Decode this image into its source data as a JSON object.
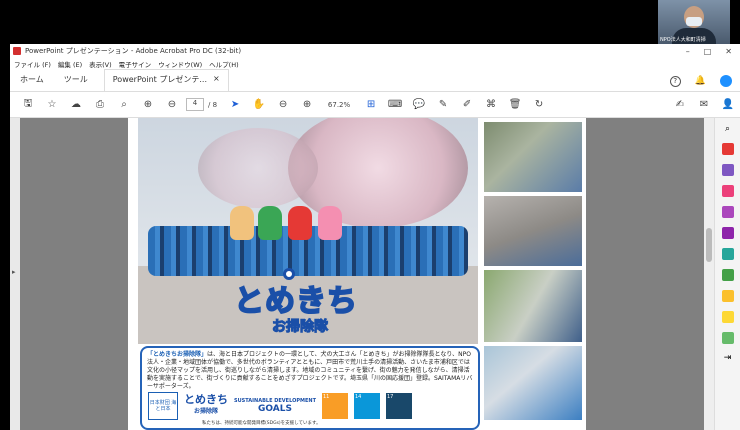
{
  "camera": {
    "name": "NPO法人大和町清掃"
  },
  "window": {
    "title": "PowerPoint プレゼンテーション - Adobe Acrobat Pro DC (32-bit)"
  },
  "menu": [
    "ファイル (F)",
    "編集 (E)",
    "表示(V)",
    "電子サイン",
    "ウィンドウ(W)",
    "ヘルプ(H)"
  ],
  "tabs": {
    "home": "ホーム",
    "tools": "ツール",
    "doc": "PowerPoint プレゼンテ...",
    "close": "×"
  },
  "toolbar": {
    "page": "4",
    "page_count": "/ 8",
    "zoom": "67.2%"
  },
  "page": {
    "logo_main": "とめきち",
    "logo_sub": "お掃除隊",
    "info_highlight": "「とめきちお掃除隊」",
    "info_text": "は、海と日本プロジェクトの一環として、犬の大工さん「とめきち」がお掃除隊隊長となり、NPO法人・企業・地域団体が協働で、多世代のボランティアとともに、戸田市で荒川土手の清掃活動、さいたま市浦和区では文化の小径マップを活用し、街巡りしながら清掃します。地域のコミュニティを繋げ、街の魅力を発信しながら、清掃活動を実施することで、街づくりに貢献することをめざすプロジェクトです。埼玉県「川の国応援団」登録。SAITAMAリバーサポーターズ。",
    "badge_jp": "日本財団 海と日本",
    "badge_logo": "とめきち",
    "badge_logo_sub": "お掃除隊",
    "sdg_label": "SUSTAINABLE DEVELOPMENT",
    "goals": "GOALS",
    "footer": "私たちは、持続可能な開発目標(SDGs)を支援しています。"
  },
  "colors": {
    "accent": "#1a5fb4",
    "sdg11": "#f99d26",
    "sdg14": "#0a97d9",
    "sdg17": "#19486a"
  }
}
